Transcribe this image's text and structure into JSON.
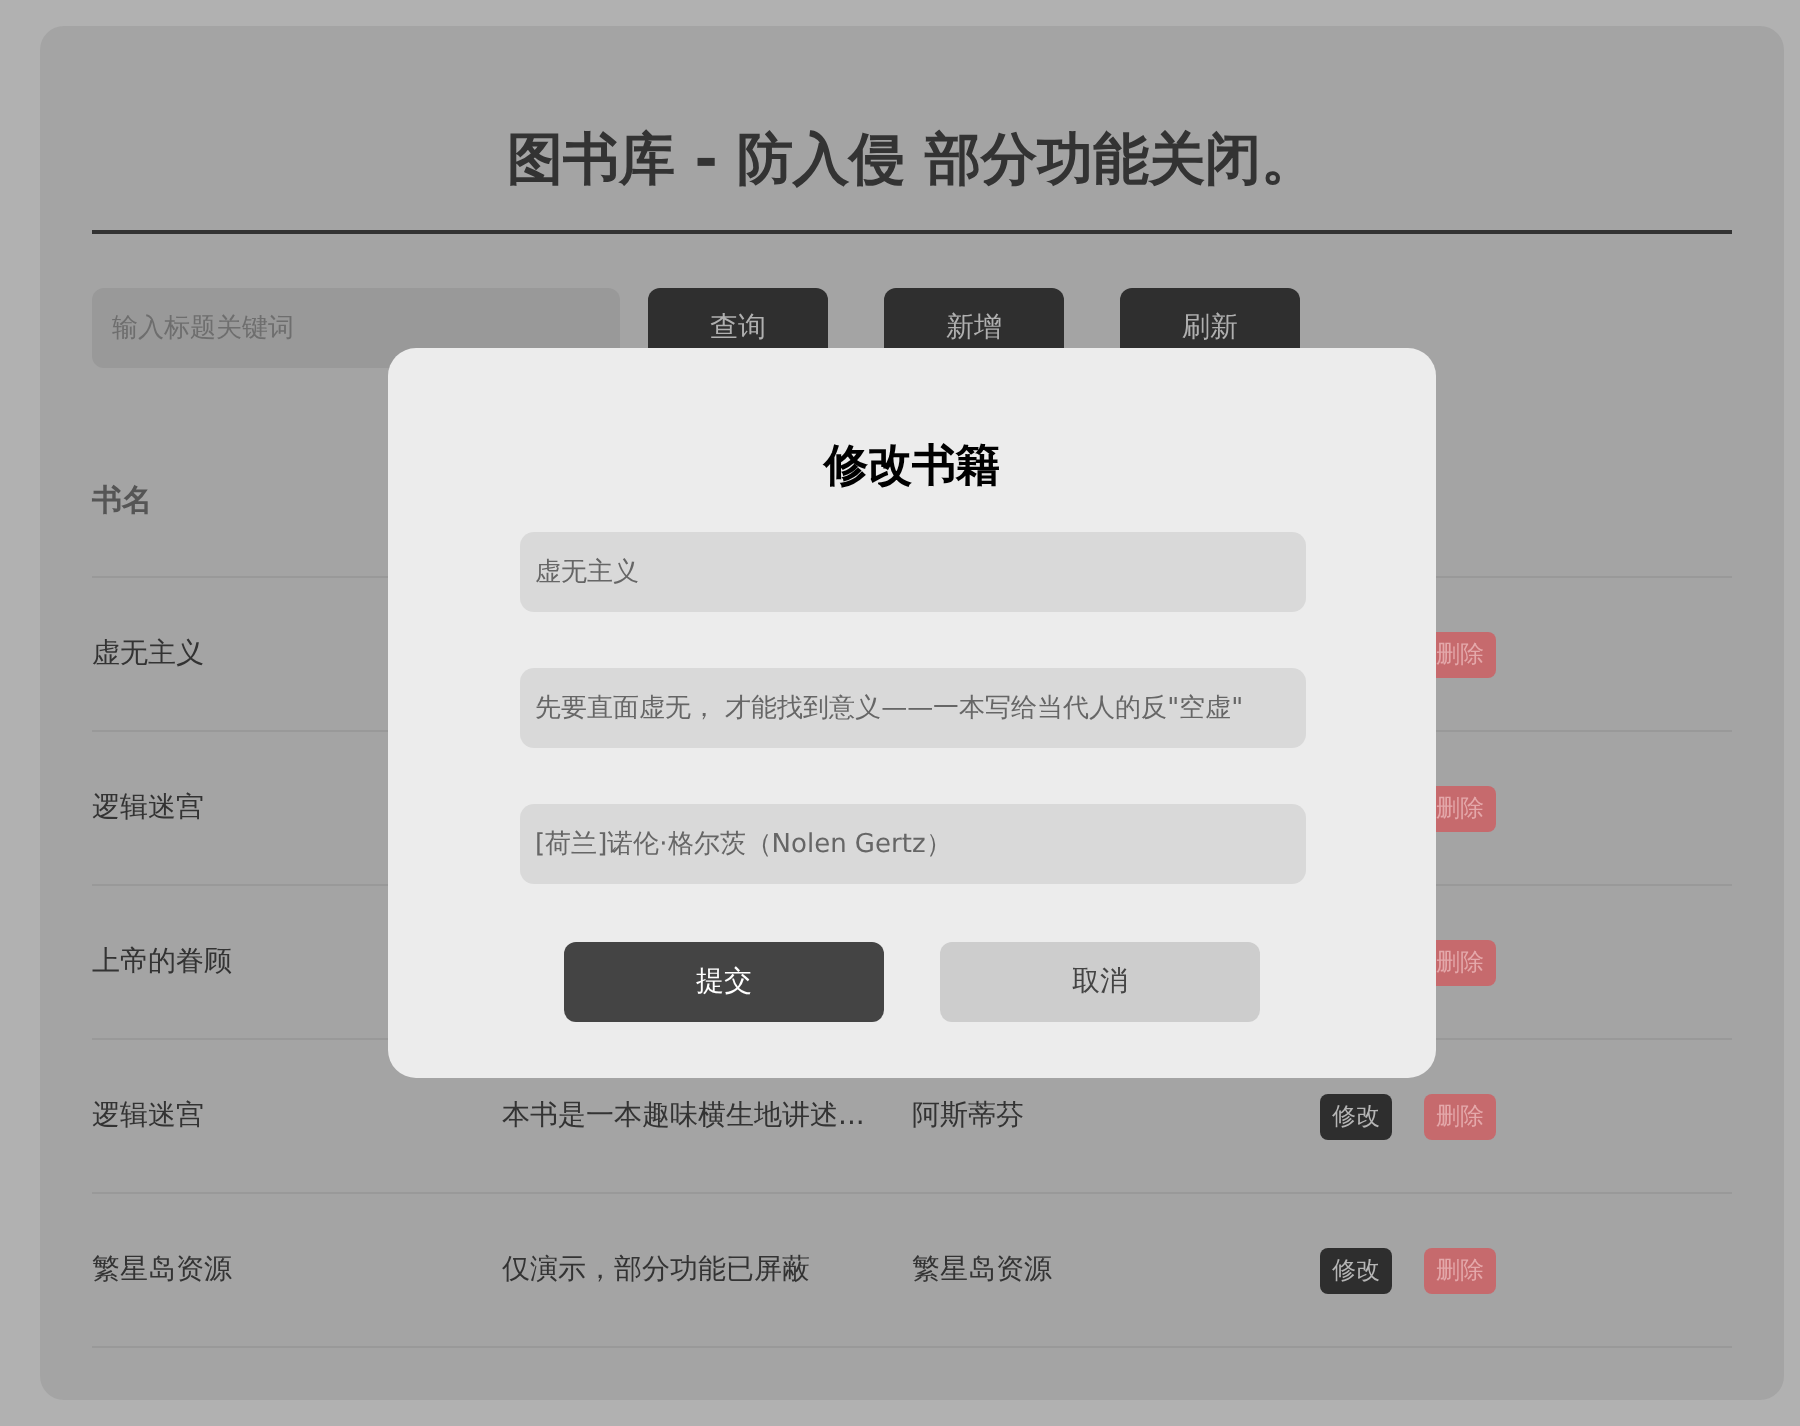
{
  "page": {
    "title": "图书库 - 防入侵 部分功能关闭。"
  },
  "toolbar": {
    "search": {
      "placeholder": "输入标题关键词"
    },
    "buttons": [
      "查询",
      "新增",
      "刷新"
    ]
  },
  "table": {
    "columns": [
      "书名"
    ],
    "rows": [
      {
        "title": "虚无主义",
        "actions": [
          {
            "label": "删除",
            "kind": "delete"
          }
        ]
      },
      {
        "title": "逻辑迷宫",
        "actions": [
          {
            "label": "删除",
            "kind": "delete"
          }
        ]
      },
      {
        "title": "上帝的眷顾",
        "actions": [
          {
            "label": "删除",
            "kind": "delete"
          }
        ]
      },
      {
        "title": "逻辑迷宫",
        "description": "本书是一本趣味横生地讲述...",
        "author": "阿斯蒂芬",
        "actions": [
          {
            "label": "修改",
            "kind": "edit"
          },
          {
            "label": "删除",
            "kind": "delete"
          }
        ]
      },
      {
        "title": "繁星岛资源",
        "description": "仅演示，部分功能已屏蔽",
        "author": "繁星岛资源",
        "actions": [
          {
            "label": "修改",
            "kind": "edit"
          },
          {
            "label": "删除",
            "kind": "delete"
          }
        ]
      }
    ]
  },
  "dialog": {
    "title": "修改书籍",
    "fields": [
      "虚无主义",
      "先要直面虚无， 才能找到意义——一本写给当代人的反\"空虚\"",
      "[荷兰]诺伦·格尔茨（Nolen Gertz）"
    ],
    "buttons": [
      {
        "label": "提交",
        "kind": "primary"
      },
      {
        "label": "取消",
        "kind": "secondary"
      }
    ]
  }
}
